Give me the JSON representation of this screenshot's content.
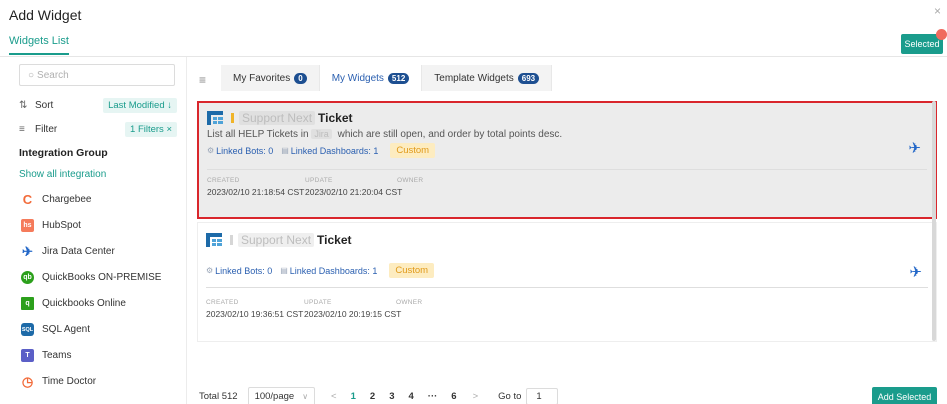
{
  "dialog": {
    "title": "Add Widget",
    "close_glyph": "×",
    "tab_label": "Widgets List",
    "selected_button": "Selected"
  },
  "sidebar": {
    "search_placeholder": "Search",
    "sort": {
      "label": "Sort",
      "value": "Last Modified ↓"
    },
    "filter": {
      "label": "Filter",
      "value": "1 Filters ×"
    },
    "group_title": "Integration Group",
    "show_all": "Show all integration",
    "integrations": [
      {
        "label": "Chargebee",
        "icon": "chargebee-icon",
        "color": "#f26b3a"
      },
      {
        "label": "HubSpot",
        "icon": "hubspot-icon",
        "color": "#f57b5b"
      },
      {
        "label": "Jira Data Center",
        "icon": "jira-icon",
        "color": "#2468c8"
      },
      {
        "label": "QuickBooks ON-PREMISE",
        "icon": "quickbooks-icon",
        "color": "#2ca01c"
      },
      {
        "label": "Quickbooks Online",
        "icon": "quickbooks-online-icon",
        "color": "#2ca01c"
      },
      {
        "label": "SQL Agent",
        "icon": "sql-agent-icon",
        "color": "#1d6aa8"
      },
      {
        "label": "Teams",
        "icon": "teams-icon",
        "color": "#5b5fc7"
      },
      {
        "label": "Time Doctor",
        "icon": "time-doctor-icon",
        "color": "#f26b3a"
      }
    ]
  },
  "tabs": [
    {
      "label": "My Favorites",
      "count": "0"
    },
    {
      "label": "My Widgets",
      "count": "512"
    },
    {
      "label": "Template Widgets",
      "count": "693"
    }
  ],
  "widgets": [
    {
      "title_blur": "Support Next",
      "title": "Ticket",
      "desc_a": "List all HELP Tickets in",
      "desc_blur": "Jira",
      "desc_b": "which are still open, and order by total points desc.",
      "linked_bots": "Linked Bots: 0",
      "linked_dashboards": "Linked Dashboards: 1",
      "tag": "Custom",
      "created_label": "CREATED",
      "created": "2023/02/10 21:18:54 CST",
      "update_label": "UPDATE",
      "update": "2023/02/10 21:20:04 CST",
      "owner_label": "OWNER"
    },
    {
      "title_blur": "Support Next",
      "title": "Ticket",
      "linked_bots": "Linked Bots: 0",
      "linked_dashboards": "Linked Dashboards: 1",
      "tag": "Custom",
      "created_label": "CREATED",
      "created": "2023/02/10 19:36:51 CST",
      "update_label": "UPDATE",
      "update": "2023/02/10 20:19:15 CST",
      "owner_label": "OWNER"
    }
  ],
  "pagination": {
    "total": "Total 512",
    "page_size": "100/page",
    "prev": "<",
    "pages": [
      "1",
      "2",
      "3",
      "4",
      "···",
      "6"
    ],
    "next": ">",
    "goto_label": "Go to",
    "goto_value": "1"
  },
  "add_selected": "Add Selected",
  "colors": {
    "accent": "#1a9c8c",
    "highlight_border": "#d9262c",
    "badge": "#1d4f91"
  }
}
